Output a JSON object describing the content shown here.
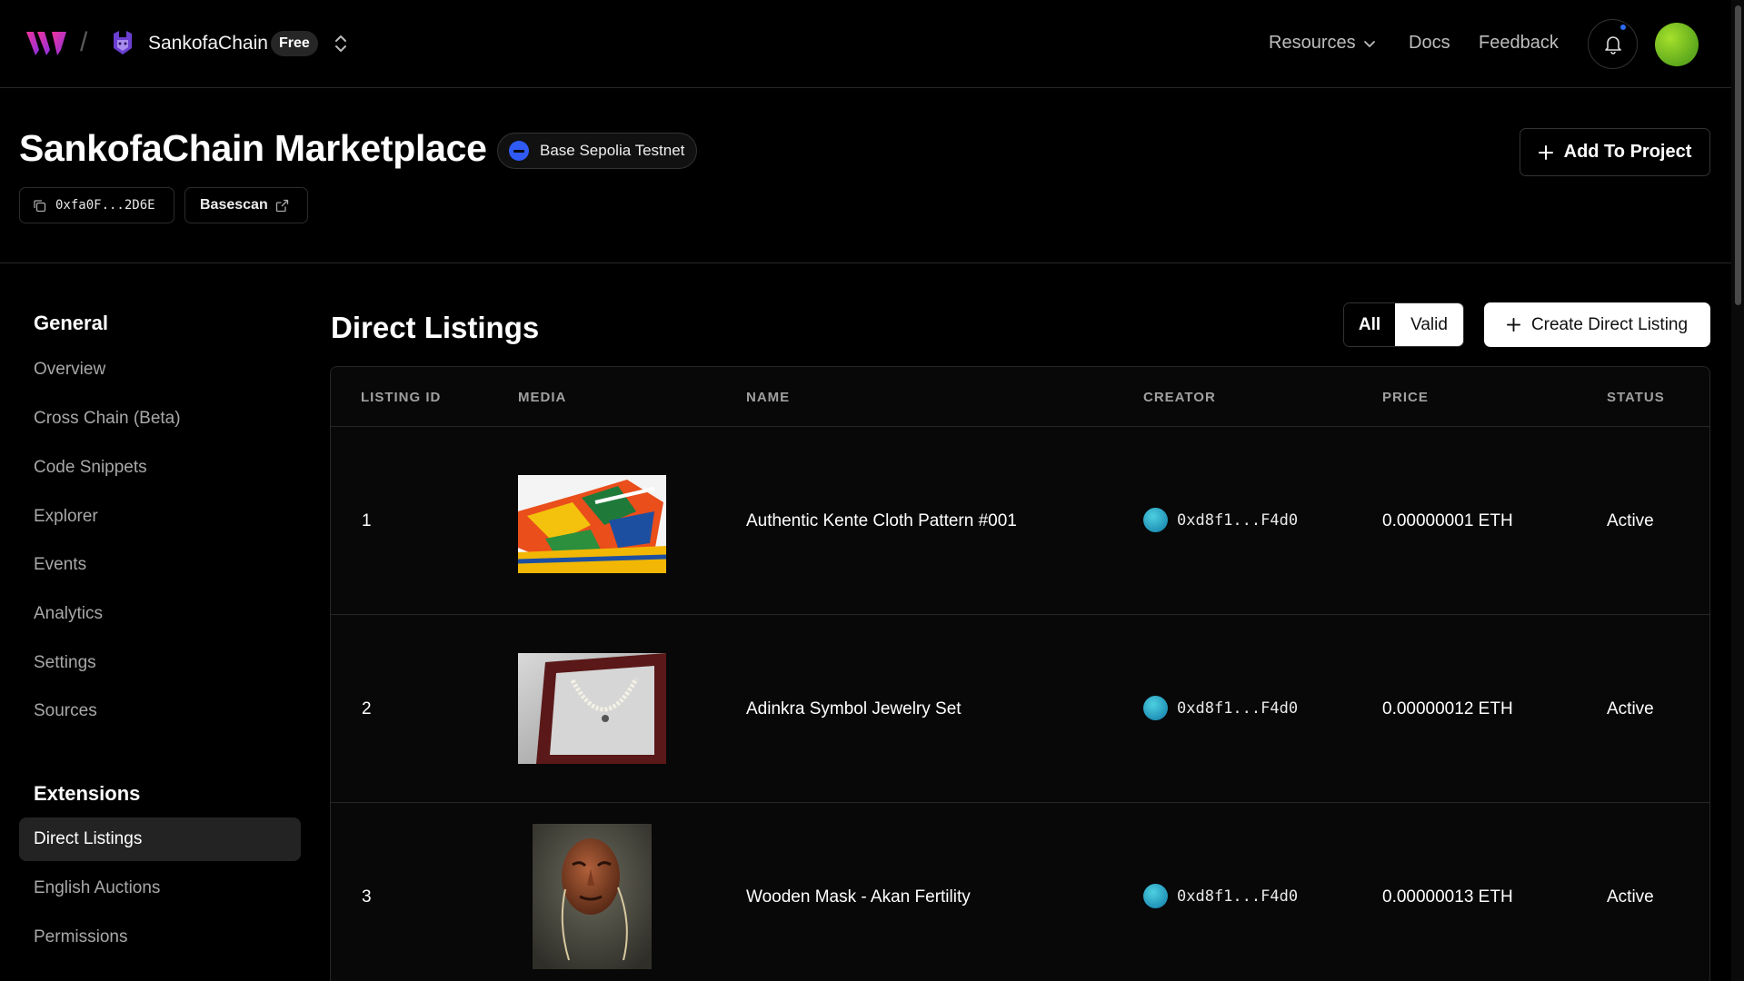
{
  "header": {
    "project_name": "SankofaChain",
    "plan_badge": "Free",
    "nav": {
      "resources": "Resources",
      "docs": "Docs",
      "feedback": "Feedback"
    }
  },
  "contract": {
    "title": "SankofaChain Marketplace",
    "chain": "Base Sepolia Testnet",
    "address": "0xfa0F...2D6E",
    "explorer": "Basescan",
    "add_to_project": "Add To Project"
  },
  "sidebar": {
    "general_heading": "General",
    "general_items": [
      {
        "label": "Overview"
      },
      {
        "label": "Cross Chain (Beta)"
      },
      {
        "label": "Code Snippets"
      },
      {
        "label": "Explorer"
      },
      {
        "label": "Events"
      },
      {
        "label": "Analytics"
      },
      {
        "label": "Settings"
      },
      {
        "label": "Sources"
      }
    ],
    "extensions_heading": "Extensions",
    "extension_items": [
      {
        "label": "Direct Listings",
        "active": true
      },
      {
        "label": "English Auctions"
      },
      {
        "label": "Permissions"
      }
    ]
  },
  "main": {
    "title": "Direct Listings",
    "filter": {
      "all": "All",
      "valid": "Valid",
      "selected": "Valid"
    },
    "create_label": "Create Direct Listing",
    "columns": [
      "LISTING ID",
      "MEDIA",
      "NAME",
      "CREATOR",
      "PRICE",
      "STATUS"
    ],
    "rows": [
      {
        "id": "1",
        "name": "Authentic Kente Cloth Pattern #001",
        "creator": "0xd8f1...F4d0",
        "price": "0.00000001 ETH",
        "status": "Active"
      },
      {
        "id": "2",
        "name": "Adinkra Symbol Jewelry Set",
        "creator": "0xd8f1...F4d0",
        "price": "0.00000012 ETH",
        "status": "Active"
      },
      {
        "id": "3",
        "name": "Wooden Mask - Akan Fertility",
        "creator": "0xd8f1...F4d0",
        "price": "0.00000013 ETH",
        "status": "Active"
      }
    ]
  },
  "colors": {
    "background": "#000000",
    "accent_blue": "#2f5bf4",
    "avatar_green": "#7cc722",
    "creator_teal": "#2aa8c8"
  },
  "icons": [
    "brand-logo-icon",
    "project-icon",
    "switch-icon",
    "chevron-down-icon",
    "bell-icon",
    "copy-icon",
    "external-link-icon",
    "plus-icon"
  ]
}
